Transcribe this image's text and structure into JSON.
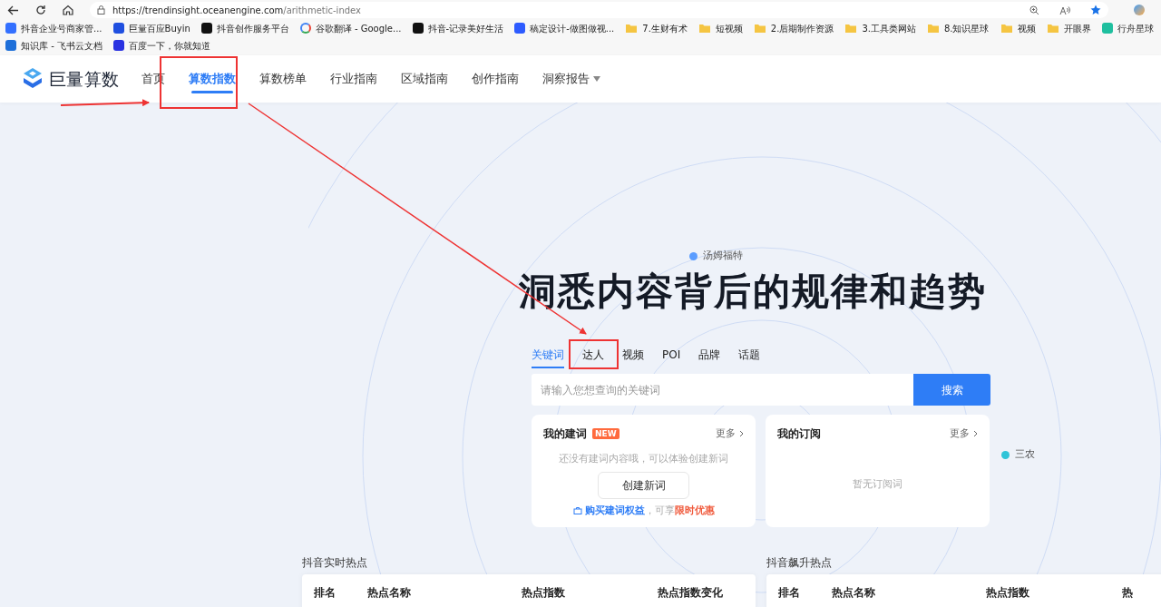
{
  "browser": {
    "url_host": "https://trendinsight.oceanengine.com",
    "url_path": "/arithmetic-index",
    "bookmarks": [
      {
        "label": "抖音企业号商家管...",
        "kind": "app",
        "color": "#3370ff"
      },
      {
        "label": "巨量百应Buyin",
        "kind": "app",
        "color": "#1f4fe0"
      },
      {
        "label": "抖音创作服务平台",
        "kind": "app",
        "color": "#111111"
      },
      {
        "label": "谷歌翻译 - Google...",
        "kind": "google",
        "color": "#4285f4"
      },
      {
        "label": "抖音-记录美好生活",
        "kind": "app",
        "color": "#111111"
      },
      {
        "label": "稿定设计-做图做视...",
        "kind": "app",
        "color": "#2d5bff"
      },
      {
        "label": "7.生财有术",
        "kind": "folder",
        "color": "#f5c542"
      },
      {
        "label": "短视频",
        "kind": "folder",
        "color": "#f5c542"
      },
      {
        "label": "2.后期制作资源",
        "kind": "folder",
        "color": "#f5c542"
      },
      {
        "label": "3.工具类网站",
        "kind": "folder",
        "color": "#f5c542"
      },
      {
        "label": "8.知识星球",
        "kind": "folder",
        "color": "#f5c542"
      },
      {
        "label": "视频",
        "kind": "folder",
        "color": "#f5c542"
      },
      {
        "label": "开眼界",
        "kind": "folder",
        "color": "#f5c542"
      },
      {
        "label": "行舟星球",
        "kind": "app",
        "color": "#1fbf9f"
      },
      {
        "label": "知识库 - 飞书云文档",
        "kind": "app",
        "color": "#1e6fd9"
      },
      {
        "label": "百度一下，你就知道",
        "kind": "app",
        "color": "#2932e1"
      }
    ]
  },
  "header": {
    "logo": "巨量算数",
    "nav": [
      {
        "label": "首页",
        "selected": false
      },
      {
        "label": "算数指数",
        "selected": true
      },
      {
        "label": "算数榜单",
        "selected": false
      },
      {
        "label": "行业指南",
        "selected": false
      },
      {
        "label": "区域指南",
        "selected": false
      },
      {
        "label": "创作指南",
        "selected": false
      },
      {
        "label": "洞察报告",
        "selected": false,
        "dropdown": true
      }
    ]
  },
  "bubbles": [
    {
      "label": "汤姆福特",
      "color": "#5b9dff"
    },
    {
      "label": "三农",
      "color": "#2fc4d8"
    }
  ],
  "hero": {
    "title": "洞悉内容背后的规律和趋势",
    "tabs": [
      {
        "label": "关键词",
        "selected": true
      },
      {
        "label": "达人",
        "selected": false
      },
      {
        "label": "视频",
        "selected": false
      },
      {
        "label": "POI",
        "selected": false
      },
      {
        "label": "品牌",
        "selected": false
      },
      {
        "label": "话题",
        "selected": false
      }
    ],
    "search": {
      "placeholder": "请输入您想查询的关键词",
      "button": "搜索"
    }
  },
  "cards": [
    {
      "kind": "words",
      "title": "我的建词",
      "badge": "NEW",
      "more": "更多",
      "empty": "还没有建词内容哦，可以体验创建新词",
      "button": "创建新词",
      "promo_link": "购买建词权益",
      "promo_text": "，可享",
      "promo_highlight": "限时优惠"
    },
    {
      "kind": "subscriptions",
      "title": "我的订阅",
      "more": "更多",
      "empty": "暂无订阅词"
    }
  ],
  "hot_lists": [
    {
      "title": "抖音实时热点",
      "columns": [
        "排名",
        "热点名称",
        "热点指数",
        "热点指数变化"
      ]
    },
    {
      "title": "抖音飙升热点",
      "columns": [
        "排名",
        "热点名称",
        "热点指数",
        "热"
      ]
    }
  ],
  "annotations": [
    {
      "kind": "box"
    },
    {
      "kind": "box"
    },
    {
      "kind": "arrow"
    },
    {
      "kind": "arrow"
    }
  ]
}
